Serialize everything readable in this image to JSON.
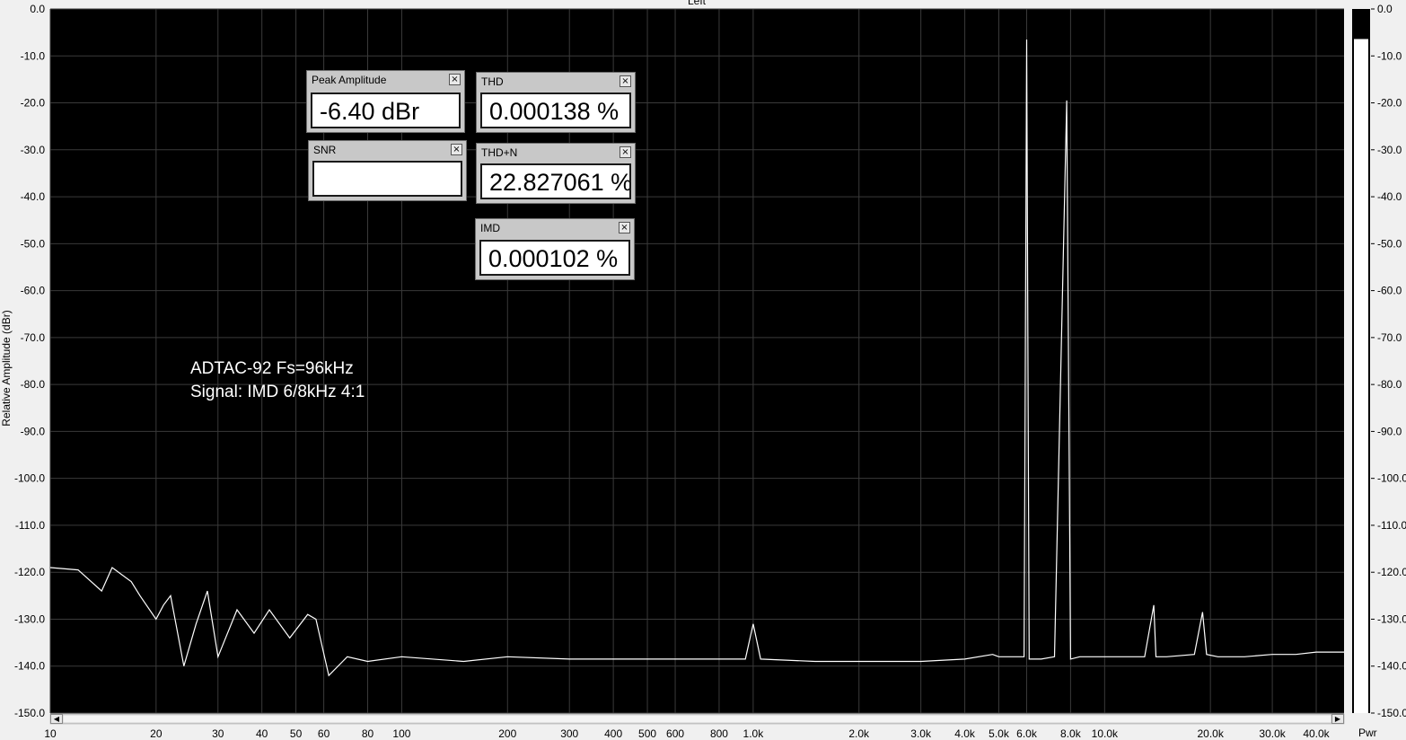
{
  "window": {
    "channel_label": "Left"
  },
  "chart_data": {
    "type": "line",
    "title": "",
    "ylabel": "Relative Amplitude (dBr)",
    "xlabel": "",
    "xscale": "log",
    "xlim": [
      10,
      48000
    ],
    "ylim": [
      -150,
      0
    ],
    "grid": true,
    "background": "#000000",
    "line_color": "#ffffff",
    "y_ticks": [
      "0.0",
      "-10.0",
      "-20.0",
      "-30.0",
      "-40.0",
      "-50.0",
      "-60.0",
      "-70.0",
      "-80.0",
      "-90.0",
      "-100.0",
      "-110.0",
      "-120.0",
      "-130.0",
      "-140.0",
      "-150.0"
    ],
    "x_ticks": [
      {
        "v": 10,
        "label": "10"
      },
      {
        "v": 20,
        "label": "20"
      },
      {
        "v": 30,
        "label": "30"
      },
      {
        "v": 40,
        "label": "40"
      },
      {
        "v": 50,
        "label": "50"
      },
      {
        "v": 60,
        "label": "60"
      },
      {
        "v": 80,
        "label": "80"
      },
      {
        "v": 100,
        "label": "100"
      },
      {
        "v": 200,
        "label": "200"
      },
      {
        "v": 300,
        "label": "300"
      },
      {
        "v": 400,
        "label": "400"
      },
      {
        "v": 500,
        "label": "500"
      },
      {
        "v": 600,
        "label": "600"
      },
      {
        "v": 800,
        "label": "800"
      },
      {
        "v": 1000,
        "label": "1.0k"
      },
      {
        "v": 2000,
        "label": "2.0k"
      },
      {
        "v": 3000,
        "label": "3.0k"
      },
      {
        "v": 4000,
        "label": "4.0k"
      },
      {
        "v": 5000,
        "label": "5.0k"
      },
      {
        "v": 6000,
        "label": "6.0k"
      },
      {
        "v": 8000,
        "label": "8.0k"
      },
      {
        "v": 10000,
        "label": "10.0k"
      },
      {
        "v": 20000,
        "label": "20.0k"
      },
      {
        "v": 30000,
        "label": "30.0k"
      },
      {
        "v": 40000,
        "label": "40.0k"
      }
    ],
    "series": [
      {
        "x": [
          10,
          12,
          14,
          15,
          17,
          18,
          20,
          21,
          22,
          24,
          26,
          28,
          30,
          34,
          38,
          42,
          48,
          54,
          57,
          62,
          70,
          80,
          100,
          150,
          200,
          300,
          500,
          700,
          950,
          1000,
          1050,
          1500,
          2000,
          3000,
          4000,
          4800,
          5000,
          5900,
          6000,
          6100,
          6600,
          7200,
          7800,
          8000,
          8500,
          10000,
          12000,
          13000,
          13800,
          14000,
          15000,
          18000,
          19000,
          19500,
          21000,
          25000,
          30000,
          35000,
          40000,
          48000
        ],
        "y": [
          -119,
          -119.5,
          -124,
          -119,
          -122,
          -125,
          -130,
          -127,
          -125,
          -140,
          -131,
          -124,
          -138,
          -128,
          -133,
          -128,
          -134,
          -129,
          -130,
          -142,
          -138,
          -139,
          -138,
          -139,
          -138,
          -138.5,
          -138.5,
          -138.5,
          -138.5,
          -131,
          -138.5,
          -139,
          -139,
          -139,
          -138.5,
          -137.5,
          -138,
          -138,
          -6.5,
          -138.5,
          -138.5,
          -138,
          -19.5,
          -138.5,
          -138,
          -138,
          -138,
          -138,
          -127,
          -138,
          -138,
          -137.5,
          -128.5,
          -137.5,
          -138,
          -138,
          -137.5,
          -137.5,
          -137,
          -137
        ]
      }
    ],
    "annotations": [
      "ADTAC-92 Fs=96kHz",
      "Signal: IMD 6/8kHz 4:1"
    ],
    "meter": {
      "ticks": [
        "0.0",
        "-10.0",
        "-20.0",
        "-30.0",
        "-40.0",
        "-50.0",
        "-60.0",
        "-70.0",
        "-80.0",
        "-90.0",
        "-100.0",
        "-110.0",
        "-120.0",
        "-130.0",
        "-140.0",
        "-150.0"
      ],
      "level_dbr": -6.4,
      "label": "Pwr"
    }
  },
  "widgets": {
    "peak_amplitude": {
      "title": "Peak Amplitude",
      "value": "-6.40 dBr"
    },
    "snr": {
      "title": "SNR",
      "value": ""
    },
    "thd": {
      "title": "THD",
      "value": "0.000138 %"
    },
    "thd_n": {
      "title": "THD+N",
      "value": "22.827061 %"
    },
    "imd": {
      "title": "IMD",
      "value": "0.000102 %"
    }
  }
}
